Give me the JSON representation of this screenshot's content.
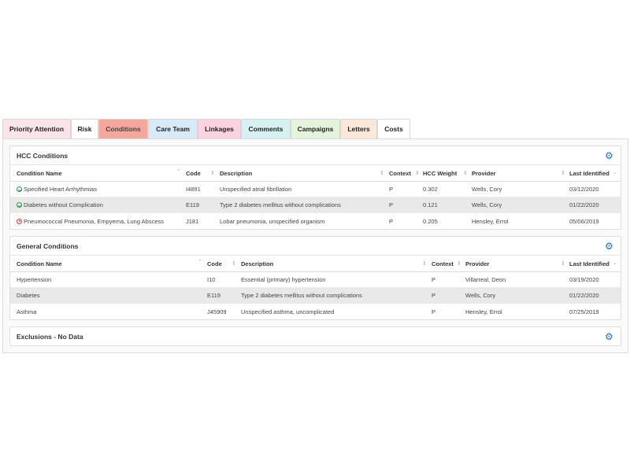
{
  "tabs": [
    {
      "label": "Priority Attention",
      "color": "#fbe4e9"
    },
    {
      "label": "Risk",
      "color": "#ffffff"
    },
    {
      "label": "Conditions",
      "color": "#f4a79b",
      "active": true
    },
    {
      "label": "Care Team",
      "color": "#d8e9f7"
    },
    {
      "label": "Linkages",
      "color": "#fbd3e0"
    },
    {
      "label": "Comments",
      "color": "#d6f1f1"
    },
    {
      "label": "Campaigns",
      "color": "#e3f3dc"
    },
    {
      "label": "Letters",
      "color": "#fce8d8"
    },
    {
      "label": "Costs",
      "color": "#ffffff"
    }
  ],
  "hcc": {
    "title": "HCC Conditions",
    "headers": {
      "name": "Condition Name",
      "code": "Code",
      "description": "Description",
      "context": "Context",
      "weight": "HCC Weight",
      "provider": "Provider",
      "last": "Last Identified"
    },
    "rows": [
      {
        "status": "ok",
        "name": "Specified Heart Arrhythmias",
        "code": "I4891",
        "description": "Unspecified atrial fibrillation",
        "context": "P",
        "weight": "0.302",
        "provider": "Wells, Cory",
        "last": "03/12/2020"
      },
      {
        "status": "ok",
        "name": "Diabetes without Complication",
        "code": "E119",
        "description": "Type 2 diabetes mellitus without complications",
        "context": "P",
        "weight": "0.121",
        "provider": "Wells, Cory",
        "last": "01/22/2020"
      },
      {
        "status": "bad",
        "name": "Pneumococcal Pneumonia, Empyema, Lung Abscess",
        "code": "J181",
        "description": "Lobar pneumonia, unspecified organism",
        "context": "P",
        "weight": "0.205",
        "provider": "Hensley, Errol",
        "last": "05/06/2019"
      }
    ]
  },
  "general": {
    "title": "General Conditions",
    "headers": {
      "name": "Condition Name",
      "code": "Code",
      "description": "Description",
      "context": "Context",
      "provider": "Provider",
      "last": "Last Identified"
    },
    "rows": [
      {
        "name": "Hypertension",
        "code": "I10",
        "description": "Essential (primary) hypertension",
        "context": "P",
        "provider": "Villarreal, Deon",
        "last": "03/19/2020"
      },
      {
        "name": "Diabetes",
        "code": "E119",
        "description": "Type 2 diabetes mellitus without complications",
        "context": "P",
        "provider": "Wells, Cory",
        "last": "01/22/2020"
      },
      {
        "name": "Asthma",
        "code": "J45909",
        "description": "Unspecified asthma, uncomplicated",
        "context": "P",
        "provider": "Hensley, Errol",
        "last": "07/25/2019"
      }
    ]
  },
  "exclusions": {
    "title": "Exclusions - No Data"
  },
  "icons": {
    "gear": "gear-icon",
    "ok": "check-circle-icon",
    "bad": "error-circle-icon"
  },
  "colors": {
    "accent": "#1a73c9",
    "ok": "#2a9a4a",
    "bad": "#dd3333",
    "alt_row": "#e9e9e9"
  },
  "glyphs": {
    "gear": "⚙",
    "sort_up": "⌃",
    "sort_both": "⇕",
    "sort_down": "⌄"
  }
}
